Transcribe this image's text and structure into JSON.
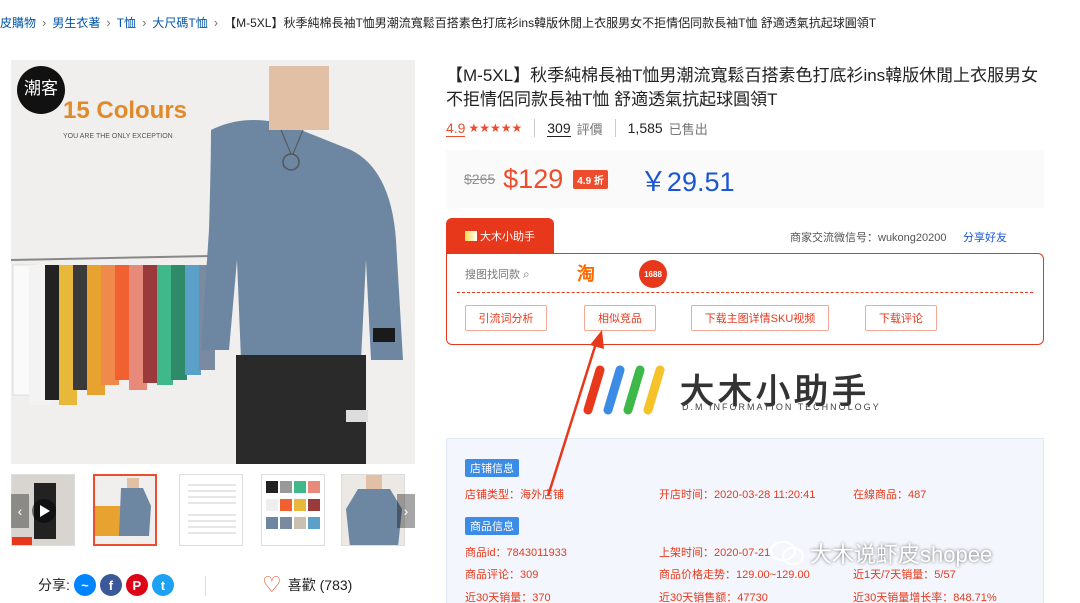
{
  "breadcrumb": {
    "items": [
      "蝦皮購物",
      "男生衣著",
      "T恤",
      "大尺碼T恤"
    ],
    "current": "【M-5XL】秋季純棉長袖T恤男潮流寬鬆百搭素色打底衫ins韓版休閒上衣服男女不拒情侶同款長袖T恤 舒適透氣抗起球圓領T"
  },
  "gallery": {
    "brand_badge": "潮客",
    "promo_title": "15 Colours",
    "promo_sub": "YOU ARE THE ONLY EXCEPTION"
  },
  "product": {
    "title": "【M-5XL】秋季純棉長袖T恤男潮流寬鬆百搭素色打底衫ins韓版休閒上衣服男女不拒情侶同款長袖T恤 舒適透氣抗起球圓領T",
    "rating": "4.9",
    "stars": "★★★★★",
    "reviews_count": "309",
    "reviews_label": "評價",
    "sold_count": "1,585",
    "sold_label": "已售出",
    "original_price": "$265",
    "price": "$129",
    "discount": "4.9 折",
    "cny_price": "￥29.51"
  },
  "share": {
    "label": "分享:",
    "like_label": "喜歡 (783)"
  },
  "plugin": {
    "tab_label": "大木小助手",
    "wechat": "商家交流微信号：wukong20200",
    "share_link": "分享好友",
    "search_label": "搜图找同款",
    "taobao": "淘",
    "alibaba": "1688",
    "buttons": [
      "引流词分析",
      "相似竞品",
      "下载主图详情SKU视频",
      "下载评论"
    ]
  },
  "logo": {
    "text": "大木小助手",
    "sub": "D.M INFORMATION TECHNOLOGY"
  },
  "store_info": {
    "tag": "店铺信息",
    "type": "店铺类型：海外店铺",
    "open_time": "开店时间：2020-03-28 11:20:41",
    "online_items": "在線商品：487"
  },
  "item_info": {
    "tag": "商品信息",
    "id": "商品id：7843011933",
    "listed": "上架时间：2020-07-21",
    "reviews": "商品评论：309",
    "price_trend": "商品价格走势：129.00~129.00",
    "sales_ratio": "近1天/7天销量：5/57",
    "sales_30": "近30天销量：370",
    "revenue_30": "近30天销售额：47730",
    "growth_30": "近30天销量增长率：848.71%"
  },
  "watermark": {
    "text": "大木说虾皮shopee"
  },
  "colors": {
    "shopee_orange": "#ee4d2d",
    "plugin_red": "#e8381b",
    "cny_blue": "#1a55d8",
    "panel_tag_blue": "#3c8ce6"
  }
}
